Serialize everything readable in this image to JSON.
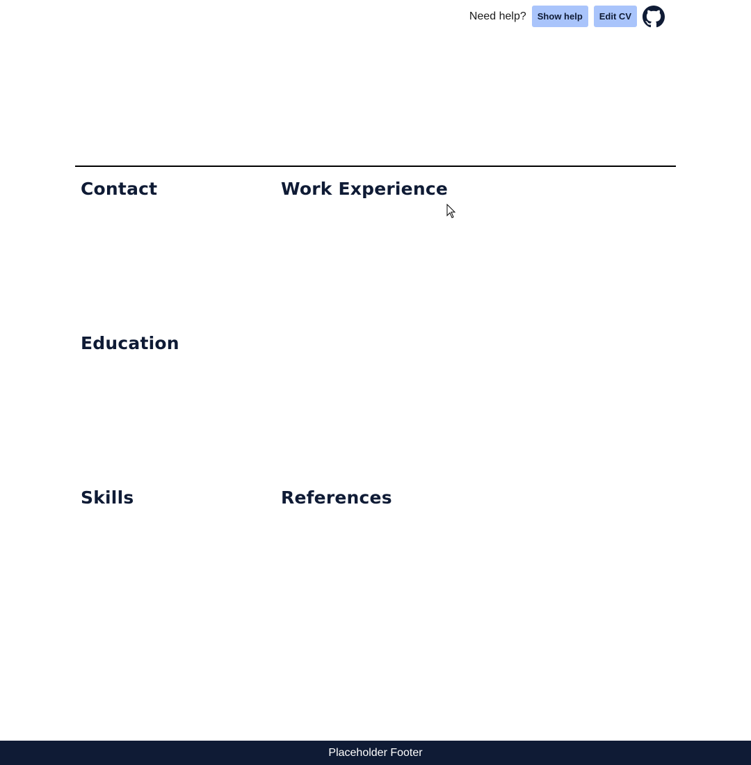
{
  "header": {
    "help_text": "Need help?",
    "show_help_label": "Show help",
    "edit_cv_label": "Edit CV",
    "github_icon": "github-icon"
  },
  "sections": {
    "contact": "Contact",
    "work_experience": "Work Experience",
    "education": "Education",
    "skills": "Skills",
    "references": "References"
  },
  "footer": {
    "text": "Placeholder Footer"
  },
  "colors": {
    "primary_dark": "#0f1b35",
    "button_bg": "#a9c4fb",
    "divider": "#000000"
  }
}
